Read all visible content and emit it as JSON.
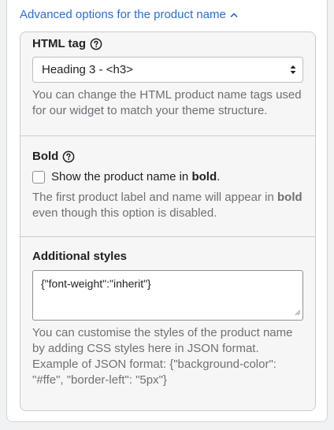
{
  "advanced_toggle": {
    "label": "Advanced options for the product name",
    "icon": "chevron-up-icon"
  },
  "html_tag": {
    "label": "HTML tag",
    "help_icon": "question-circle-icon",
    "selected": "Heading 3 - <h3>",
    "help_text": "You can change the HTML product name tags used for our widget to match your theme structure."
  },
  "bold": {
    "label": "Bold",
    "help_icon": "question-circle-icon",
    "checkbox_text_pre": "Show the product name in ",
    "checkbox_text_bold": "bold",
    "checkbox_text_post": ".",
    "checked": false,
    "help_text_pre": "The first product label and name will appear in ",
    "help_text_bold": "bold",
    "help_text_post": " even though this option is disabled."
  },
  "additional_styles": {
    "label": "Additional styles",
    "value": "{\"font-weight\":\"inherit\"}",
    "help_text": "You can customise the styles of the product name by adding CSS styles here in JSON format. Example of JSON format: {\"background-color\": \"#ffe\", \"border-left\": \"5px\"}"
  },
  "colors": {
    "link": "#2c6ecb",
    "muted_text": "#6d7175",
    "panel_bg": "#f6f6f7"
  }
}
